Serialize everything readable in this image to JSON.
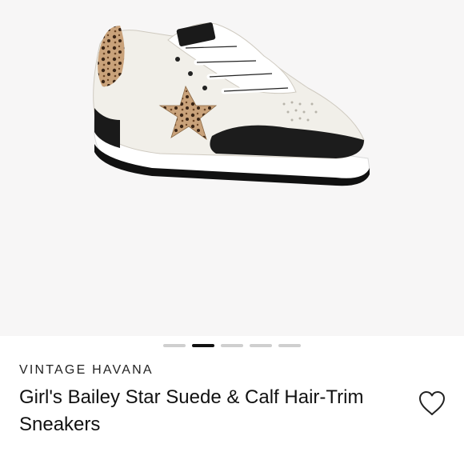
{
  "product": {
    "brand": "VINTAGE HAVANA",
    "title": "Girl's Bailey Star Suede & Calf Hair-Trim Sneakers"
  },
  "carousel": {
    "count": 5,
    "active_index": 1
  },
  "icons": {
    "favorite": "heart-outline-icon"
  },
  "colors": {
    "active_dot": "#111111",
    "inactive_dot": "#cfcfcf",
    "image_background": "#f7f6f6"
  }
}
